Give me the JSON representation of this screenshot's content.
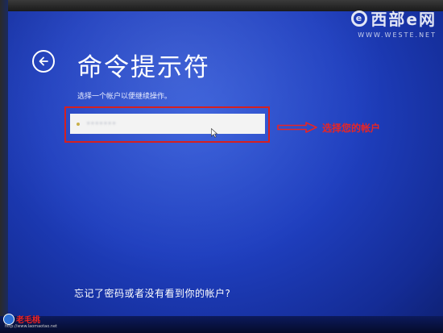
{
  "page": {
    "title": "命令提示符"
  },
  "instruction": "选择一个帐户以便继续操作。",
  "account": {
    "value": "•••••••"
  },
  "annotation": {
    "text": "选择您的帐户",
    "color": "#e82525"
  },
  "footer": {
    "forgot_link": "忘记了密码或者没有看到你的帐户?"
  },
  "watermark": {
    "brand": "西部e网",
    "logo_letter": "e",
    "url": "WWW.WESTE.NET",
    "bottom_brand": "老毛桃",
    "bottom_url": "http://www.laomaotao.net"
  },
  "colors": {
    "background": "#1f3fbf",
    "highlight_border": "#d62020",
    "text": "#ffffff"
  },
  "icons": {
    "back": "back-arrow-icon",
    "cursor": "mouse-cursor-icon",
    "arrow": "right-arrow-icon"
  }
}
